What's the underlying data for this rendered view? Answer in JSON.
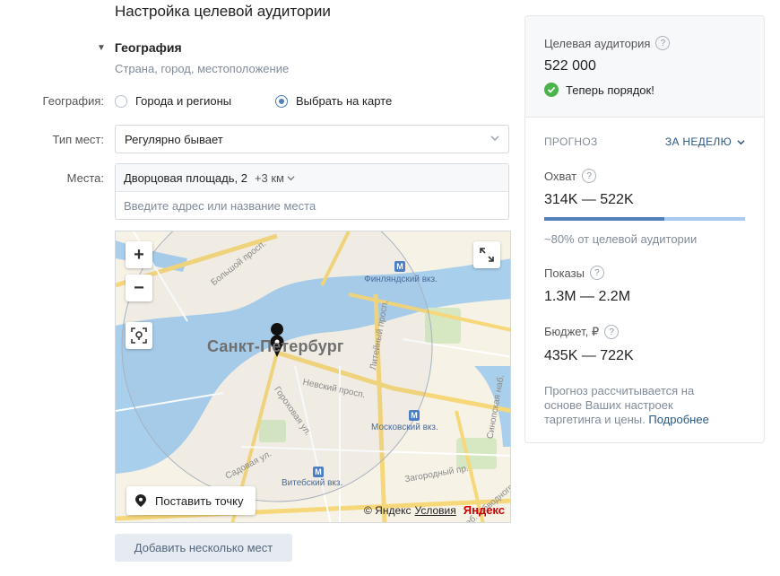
{
  "page": {
    "title": "Настройка целевой аудитории"
  },
  "geo_section": {
    "title": "География",
    "subtitle": "Страна, город, местоположение",
    "geo_label": "География:",
    "radio_options": [
      {
        "label": "Города и регионы",
        "selected": false
      },
      {
        "label": "Выбрать на карте",
        "selected": true
      }
    ],
    "place_type_label": "Тип мест:",
    "place_type_value": "Регулярно бывает",
    "places_label": "Места:",
    "place_tag": {
      "address": "Дворцовая площадь, 2",
      "radius": "+3 км"
    },
    "place_input_placeholder": "Введите адрес или название места",
    "add_many_label": "Добавить несколько мест"
  },
  "map": {
    "zoom_in": "+",
    "zoom_out": "−",
    "city_label": "Санкт-Петербург",
    "streets": [
      "Большой просп.",
      "Невский просп.",
      "Литейный просп.",
      "Гороховая ул.",
      "Садовая ул.",
      "Загородный пр.",
      "Синопская наб.",
      "наб. Обводного канала"
    ],
    "stations": [
      "Финляндский вкз.",
      "Московский вкз.",
      "Витебский вкз."
    ],
    "set_point_label": "Поставить точку",
    "copyright": "© Яндекс",
    "terms": "Условия",
    "logo_text": "Яндекс"
  },
  "panel": {
    "audience_label": "Целевая аудитория",
    "audience_value": "522 000",
    "status_text": "Теперь порядок!",
    "forecast_label": "ПРОГНОЗ",
    "period_label": "ЗА НЕДЕЛЮ",
    "reach_label": "Охват",
    "reach_value": "314K — 522K",
    "reach_progress_percent": 60,
    "reach_note": "~80% от целевой аудитории",
    "impressions_label": "Показы",
    "impressions_value": "1.3M — 2.2M",
    "budget_label": "Бюджет, ₽",
    "budget_value": "435K — 722K",
    "note_text": "Прогноз рассчитывается на основе Ваших настроек таргетинга и цены.",
    "note_link": "Подробнее"
  },
  "colors": {
    "accent": "#5181b8",
    "link": "#2a5885",
    "success": "#4bb34b",
    "muted": "#818c99",
    "button_bg": "#e5ebf1"
  }
}
